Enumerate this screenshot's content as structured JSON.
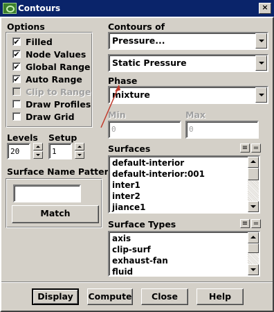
{
  "window": {
    "title": "Contours",
    "close": "×"
  },
  "options": {
    "title": "Options",
    "items": [
      {
        "label": "Filled",
        "checked": true,
        "enabled": true
      },
      {
        "label": "Node Values",
        "checked": true,
        "enabled": true
      },
      {
        "label": "Global Range",
        "checked": true,
        "enabled": true
      },
      {
        "label": "Auto Range",
        "checked": true,
        "enabled": true
      },
      {
        "label": "Clip to Range",
        "checked": false,
        "enabled": false
      },
      {
        "label": "Draw Profiles",
        "checked": false,
        "enabled": true
      },
      {
        "label": "Draw Grid",
        "checked": false,
        "enabled": true
      }
    ],
    "check_mark": "✔"
  },
  "levels": {
    "label": "Levels",
    "value": "20"
  },
  "setup": {
    "label": "Setup",
    "value": "1"
  },
  "surface_name_pattern": {
    "label": "Surface Name Pattern",
    "value": "",
    "match_label": "Match"
  },
  "contours_of": {
    "label": "Contours of",
    "category": "Pressure...",
    "quantity": "Static Pressure"
  },
  "phase": {
    "label": "Phase",
    "value": "mixture"
  },
  "range": {
    "min_label": "Min",
    "min_value": "0",
    "max_label": "Max",
    "max_value": "0"
  },
  "surfaces": {
    "label": "Surfaces",
    "items": [
      "default-interior",
      "default-interior:001",
      "inter1",
      "inter2",
      "jiance1"
    ],
    "select_all_icon": "≡",
    "deselect_all_icon": "="
  },
  "surface_types": {
    "label": "Surface Types",
    "items": [
      "axis",
      "clip-surf",
      "exhaust-fan",
      "fluid"
    ],
    "select_all_icon": "≡",
    "deselect_all_icon": "="
  },
  "buttons": {
    "display": "Display",
    "compute": "Compute",
    "close": "Close",
    "help": "Help"
  },
  "annotation": {
    "color": "#c0392b"
  }
}
